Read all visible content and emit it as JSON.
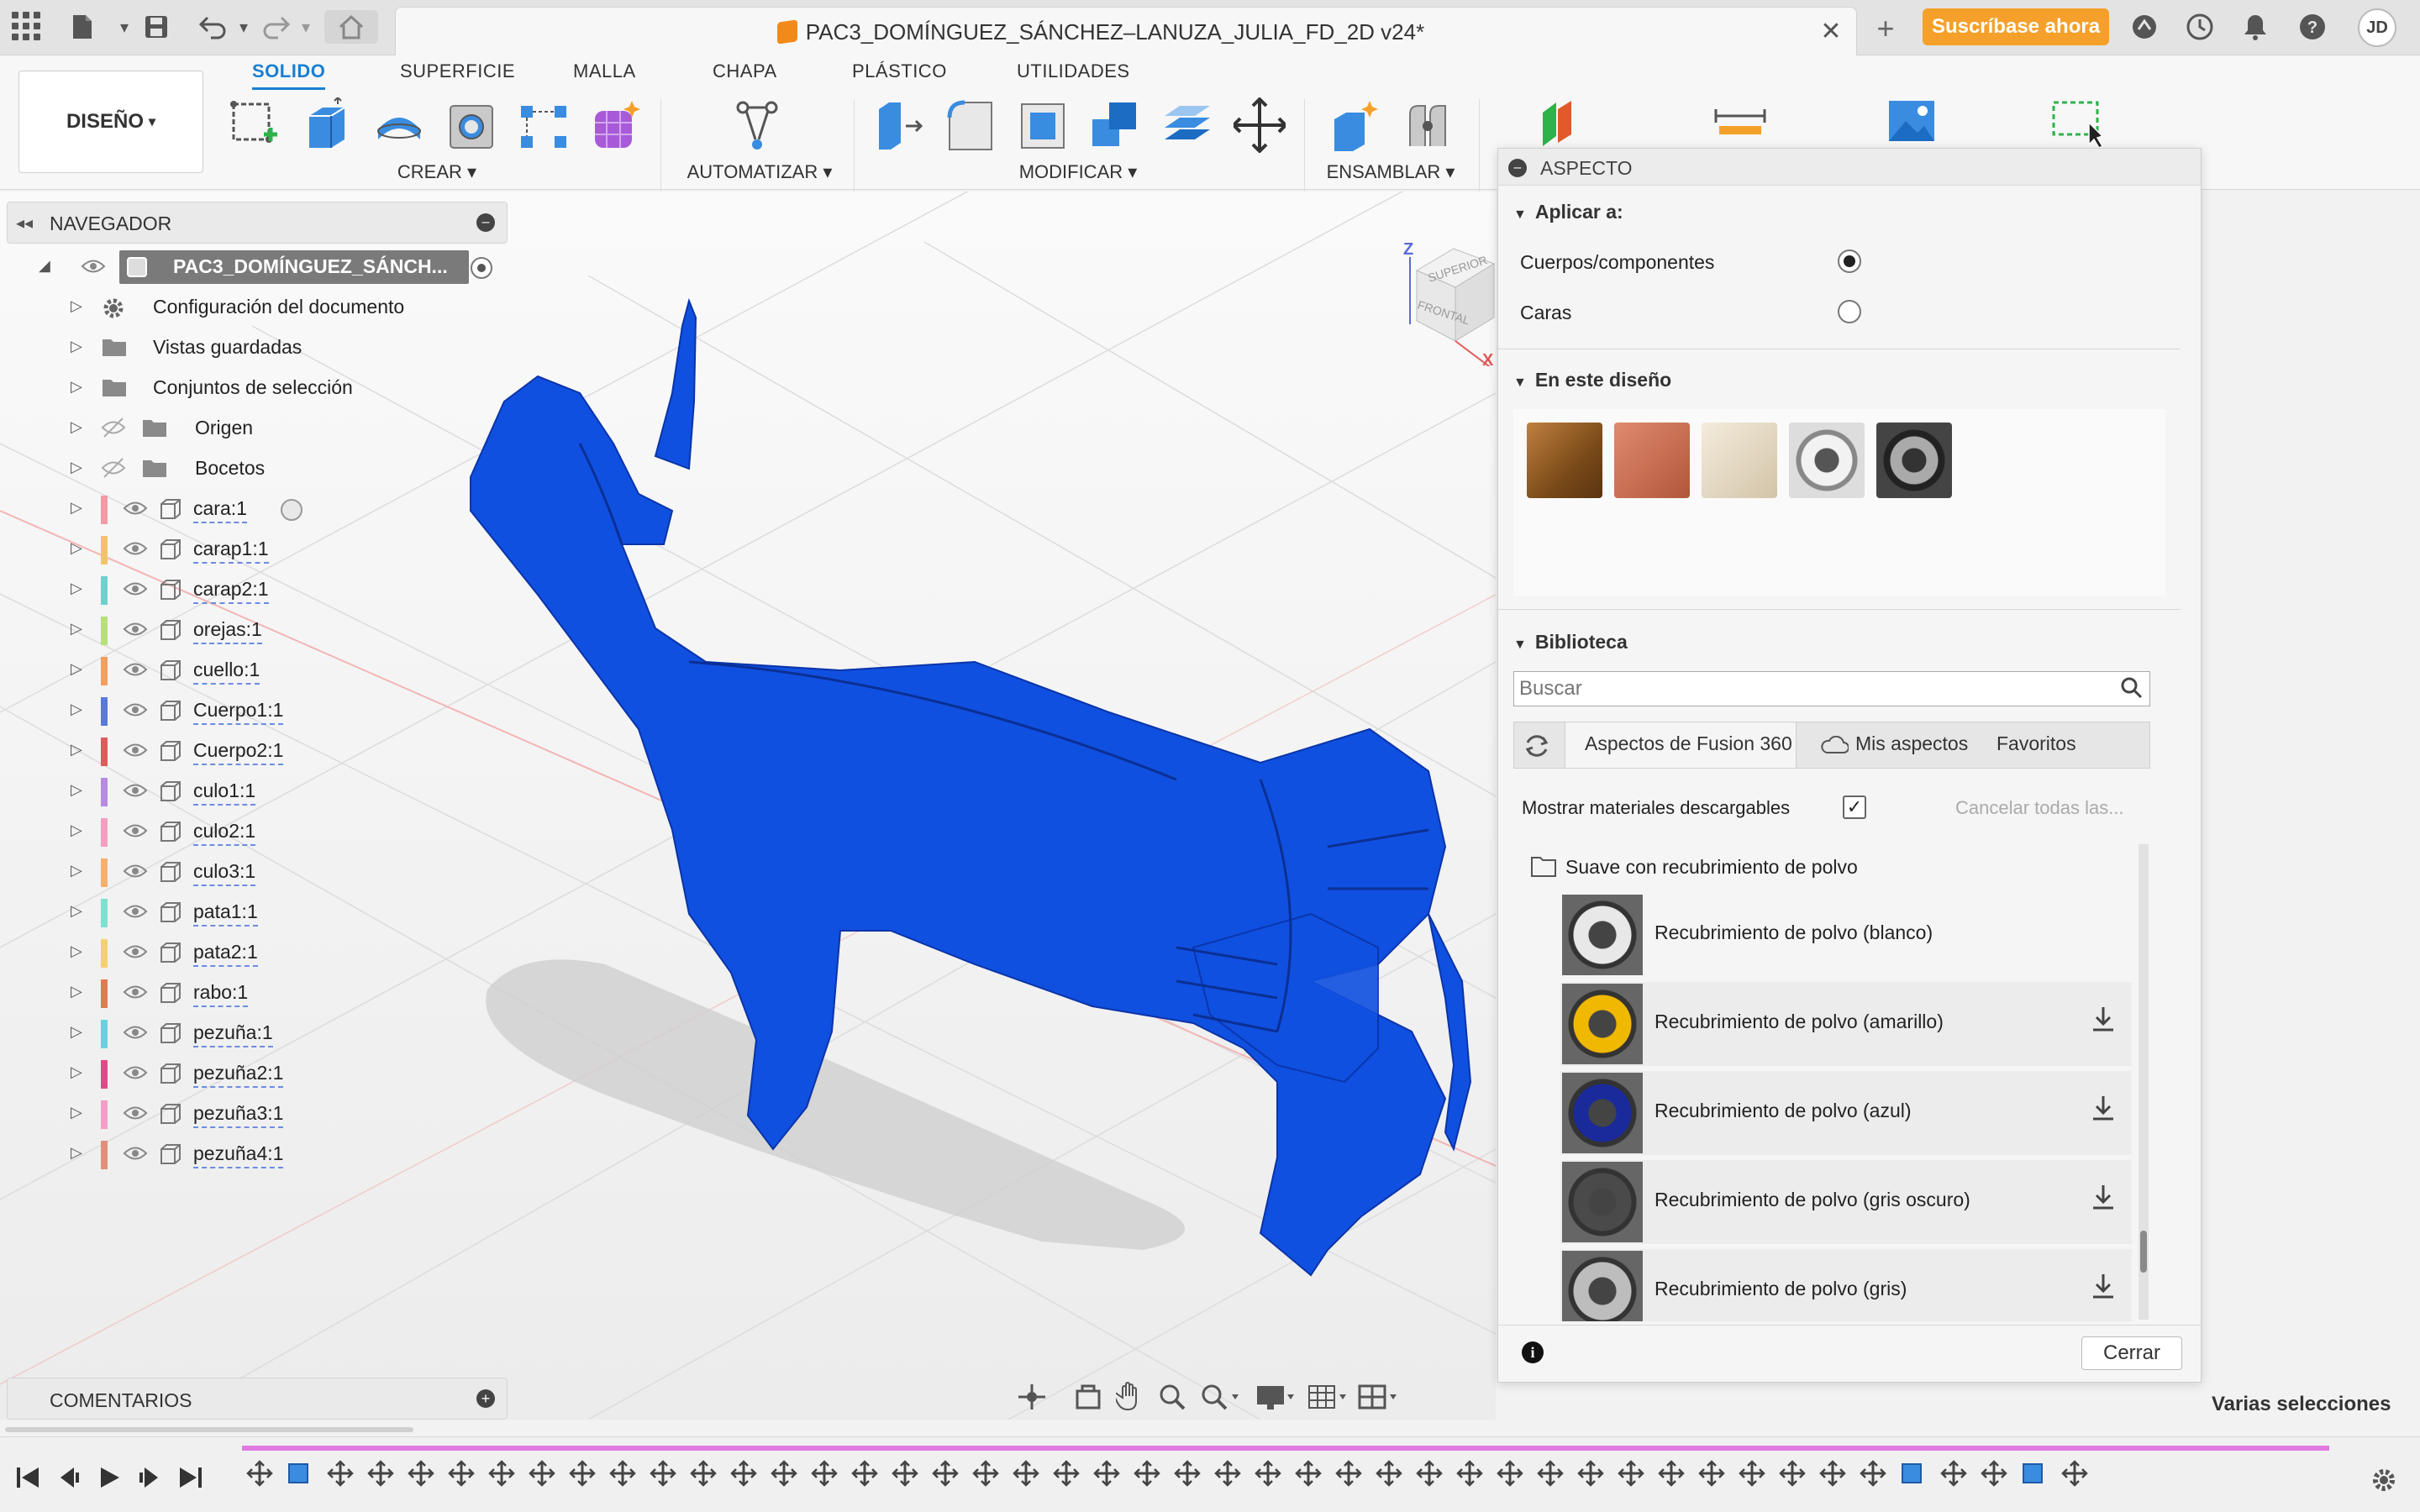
{
  "title_bar": {
    "document_title": "PAC3_DOMÍNGUEZ_SÁNCHEZ–LANUZA_JULIA_FD_2D v24*",
    "subscribe_label": "Suscríbase ahora",
    "user_initials": "JD",
    "icons": [
      "apps-grid-icon",
      "file-menu-icon",
      "save-icon",
      "undo-icon",
      "redo-icon",
      "home-icon",
      "close-icon",
      "new-tab-icon",
      "extensions-icon",
      "job-status-icon",
      "notifications-icon",
      "help-icon"
    ]
  },
  "toolbar": {
    "workspace_tabs": [
      "SOLIDO",
      "SUPERFICIE",
      "MALLA",
      "CHAPA",
      "PLÁSTICO",
      "UTILIDADES"
    ],
    "active_tab": "SOLIDO",
    "design_menu": "DISEÑO",
    "groups": {
      "crear": "CREAR",
      "automatizar": "AUTOMATIZAR",
      "modificar": "MODIFICAR",
      "ensamblar": "ENSAMBLAR"
    },
    "accent_color": "#1a7fd1"
  },
  "navigator": {
    "title": "NAVEGADOR",
    "root": "PAC3_DOMÍNGUEZ_SÁNCH...",
    "folders": [
      {
        "label": "Configuración del documento",
        "icon": "gear-icon"
      },
      {
        "label": "Vistas guardadas",
        "icon": "folder-icon"
      },
      {
        "label": "Conjuntos de selección",
        "icon": "folder-icon"
      },
      {
        "label": "Origen",
        "icon": "folder-icon",
        "hidden": true
      },
      {
        "label": "Bocetos",
        "icon": "folder-icon",
        "hidden": true
      }
    ],
    "components": [
      {
        "label": "cara:1",
        "color": "#f29aa5"
      },
      {
        "label": "carap1:1",
        "color": "#f2c46a"
      },
      {
        "label": "carap2:1",
        "color": "#6fd0d0"
      },
      {
        "label": "orejas:1",
        "color": "#b7e07a"
      },
      {
        "label": "cuello:1",
        "color": "#f0a060"
      },
      {
        "label": "Cuerpo1:1",
        "color": "#5a7ad8"
      },
      {
        "label": "Cuerpo2:1",
        "color": "#e05a5a"
      },
      {
        "label": "culo1:1",
        "color": "#b88ae0"
      },
      {
        "label": "culo2:1",
        "color": "#f2a0c0"
      },
      {
        "label": "culo3:1",
        "color": "#f5b070"
      },
      {
        "label": "pata1:1",
        "color": "#7ee0d0"
      },
      {
        "label": "pata2:1",
        "color": "#f5d070"
      },
      {
        "label": "rabo:1",
        "color": "#e07a50"
      },
      {
        "label": "pezuña:1",
        "color": "#6ad0e0"
      },
      {
        "label": "pezuña2:1",
        "color": "#e04a8a"
      },
      {
        "label": "pezuña3:1",
        "color": "#f0a0c8"
      },
      {
        "label": "pezuña4:1",
        "color": "#e0907a"
      }
    ]
  },
  "comments": {
    "title": "COMENTARIOS"
  },
  "viewcube": {
    "top": "SUPERIOR",
    "front": "FRONTAL",
    "x": "X",
    "z": "Z"
  },
  "model_color": "#1050e0",
  "aspect_panel": {
    "title": "ASPECTO",
    "apply_to": "Aplicar a:",
    "bodies": "Cuerpos/componentes",
    "faces": "Caras",
    "selected_option": "Cuerpos/componentes",
    "in_design": "En este diseño",
    "library": "Biblioteca",
    "search_placeholder": "Buscar",
    "tabs": [
      "Aspectos de Fusion 360",
      "Mis aspectos",
      "Favoritos"
    ],
    "show_downloadable": "Mostrar materiales descargables",
    "show_downloadable_checked": true,
    "cancel_all": "Cancelar todas las...",
    "folder": "Suave con recubrimiento de polvo",
    "materials": [
      {
        "label": "Recubrimiento de polvo (blanco)",
        "color": "#e8e8e8",
        "download": false
      },
      {
        "label": "Recubrimiento de polvo (amarillo)",
        "color": "#f0b800",
        "download": true
      },
      {
        "label": "Recubrimiento de polvo (azul)",
        "color": "#1a2a9a",
        "download": true
      },
      {
        "label": "Recubrimiento de polvo (gris oscuro)",
        "color": "#4a4a4a",
        "download": true
      },
      {
        "label": "Recubrimiento de polvo (gris)",
        "color": "#bdbdbd",
        "download": true
      }
    ],
    "close": "Cerrar"
  },
  "status": {
    "selection": "Varias selecciones"
  }
}
